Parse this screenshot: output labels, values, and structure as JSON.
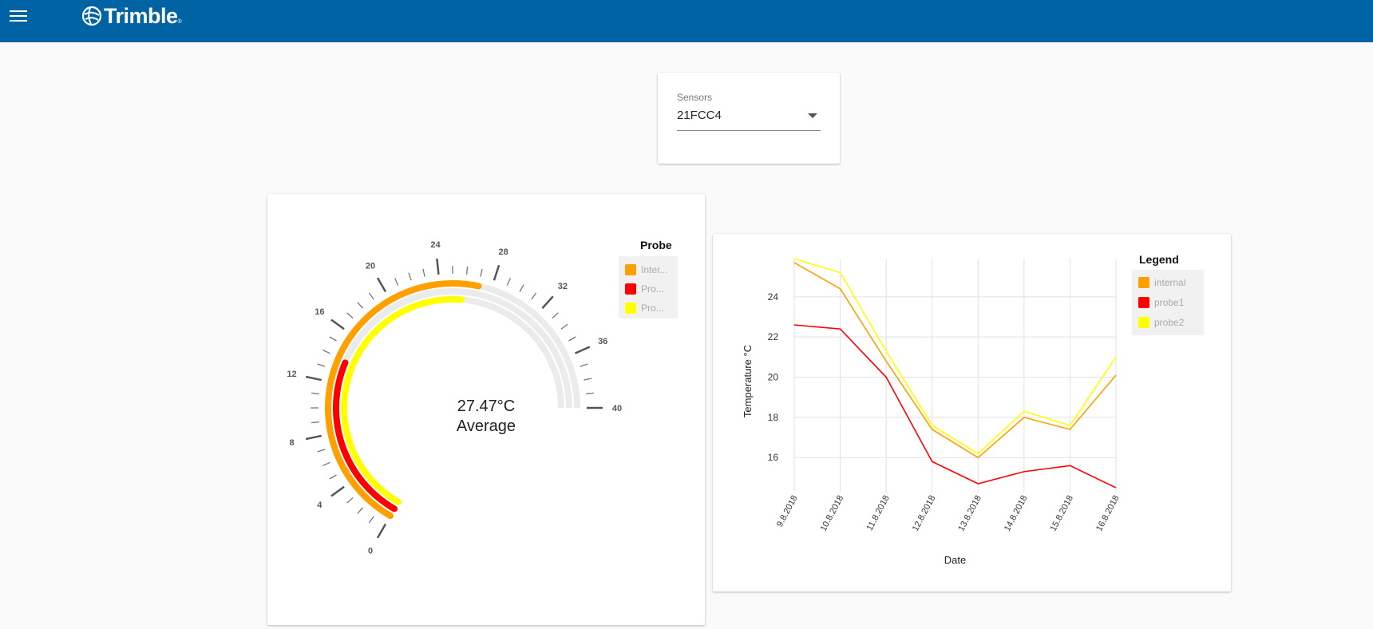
{
  "app": {
    "logo_text": "Trimble",
    "logo_reg": "®"
  },
  "sensors": {
    "label": "Sensors",
    "selected": "21FCC4"
  },
  "gauge": {
    "min": 0,
    "max": 40,
    "ticks": [
      "0",
      "4",
      "8",
      "12",
      "16",
      "20",
      "24",
      "28",
      "32",
      "36",
      "40"
    ],
    "value_text": "27.47°C",
    "caption": "Average",
    "legend_title": "Probe",
    "legend": [
      {
        "label": "Inter...",
        "color": "#ff9f00"
      },
      {
        "label": "Pro...",
        "color": "#ff0000"
      },
      {
        "label": "Pro...",
        "color": "#ffff00"
      }
    ],
    "arcs": [
      {
        "name": "internal",
        "value": 27.0,
        "color": "#ff9f00"
      },
      {
        "name": "probe1",
        "value": 13.8,
        "color": "#ff0000"
      },
      {
        "name": "probe2",
        "value": 25.8,
        "color": "#ffff00"
      }
    ]
  },
  "chart_data": {
    "type": "line",
    "xlabel": "Date",
    "ylabel": "Temperature °C",
    "categories": [
      "9.8.2018",
      "10.8.2018",
      "11.8.2018",
      "12.8.2018",
      "13.8.2018",
      "14.8.2018",
      "15.8.2018",
      "16.8.2018"
    ],
    "yticks": [
      16,
      18,
      20,
      22,
      24
    ],
    "ylim": [
      14.5,
      25.9
    ],
    "grid": true,
    "legend_title": "Legend",
    "legend_position": "right",
    "series": [
      {
        "name": "internal",
        "color": "#ff9f00",
        "values": [
          25.7,
          24.4,
          20.8,
          17.4,
          16.0,
          18.0,
          17.4,
          20.1
        ]
      },
      {
        "name": "probe1",
        "color": "#ff0000",
        "values": [
          22.6,
          22.4,
          20.0,
          15.8,
          14.7,
          15.3,
          15.6,
          14.5
        ]
      },
      {
        "name": "probe2",
        "color": "#ffff00",
        "values": [
          25.9,
          25.2,
          21.3,
          17.6,
          16.2,
          18.3,
          17.6,
          21.0
        ]
      }
    ]
  }
}
